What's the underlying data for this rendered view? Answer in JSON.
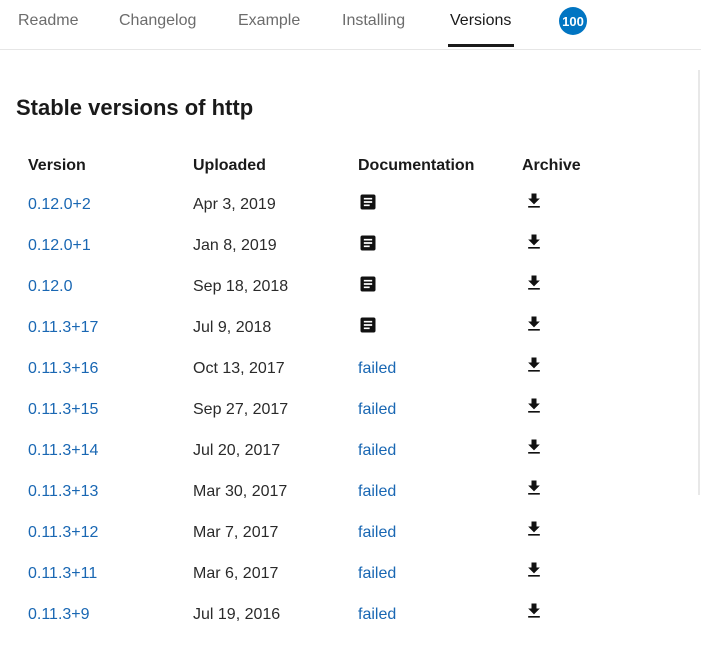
{
  "tabs": [
    {
      "label": "Readme",
      "active": false
    },
    {
      "label": "Changelog",
      "active": false
    },
    {
      "label": "Example",
      "active": false
    },
    {
      "label": "Installing",
      "active": false
    },
    {
      "label": "Versions",
      "active": true
    }
  ],
  "score_badge": "100",
  "section_title": "Stable versions of http",
  "table": {
    "headers": {
      "version": "Version",
      "uploaded": "Uploaded",
      "documentation": "Documentation",
      "archive": "Archive"
    },
    "rows": [
      {
        "version": "0.12.0+2",
        "uploaded": "Apr 3, 2019",
        "documentation": {
          "type": "icon",
          "icon": "description-icon"
        },
        "archive_icon": "download-icon"
      },
      {
        "version": "0.12.0+1",
        "uploaded": "Jan 8, 2019",
        "documentation": {
          "type": "icon",
          "icon": "description-icon"
        },
        "archive_icon": "download-icon"
      },
      {
        "version": "0.12.0",
        "uploaded": "Sep 18, 2018",
        "documentation": {
          "type": "icon",
          "icon": "description-icon"
        },
        "archive_icon": "download-icon"
      },
      {
        "version": "0.11.3+17",
        "uploaded": "Jul 9, 2018",
        "documentation": {
          "type": "icon",
          "icon": "description-icon"
        },
        "archive_icon": "download-icon"
      },
      {
        "version": "0.11.3+16",
        "uploaded": "Oct 13, 2017",
        "documentation": {
          "type": "text",
          "text": "failed"
        },
        "archive_icon": "download-icon"
      },
      {
        "version": "0.11.3+15",
        "uploaded": "Sep 27, 2017",
        "documentation": {
          "type": "text",
          "text": "failed"
        },
        "archive_icon": "download-icon"
      },
      {
        "version": "0.11.3+14",
        "uploaded": "Jul 20, 2017",
        "documentation": {
          "type": "text",
          "text": "failed"
        },
        "archive_icon": "download-icon"
      },
      {
        "version": "0.11.3+13",
        "uploaded": "Mar 30, 2017",
        "documentation": {
          "type": "text",
          "text": "failed"
        },
        "archive_icon": "download-icon"
      },
      {
        "version": "0.11.3+12",
        "uploaded": "Mar 7, 2017",
        "documentation": {
          "type": "text",
          "text": "failed"
        },
        "archive_icon": "download-icon"
      },
      {
        "version": "0.11.3+11",
        "uploaded": "Mar 6, 2017",
        "documentation": {
          "type": "text",
          "text": "failed"
        },
        "archive_icon": "download-icon"
      },
      {
        "version": "0.11.3+9",
        "uploaded": "Jul 19, 2016",
        "documentation": {
          "type": "text",
          "text": "failed"
        },
        "archive_icon": "download-icon"
      }
    ]
  },
  "colors": {
    "link": "#1967b3",
    "badge": "#0175c2",
    "text": "#1a1a1a",
    "tab_inactive": "#6c6c6c"
  }
}
